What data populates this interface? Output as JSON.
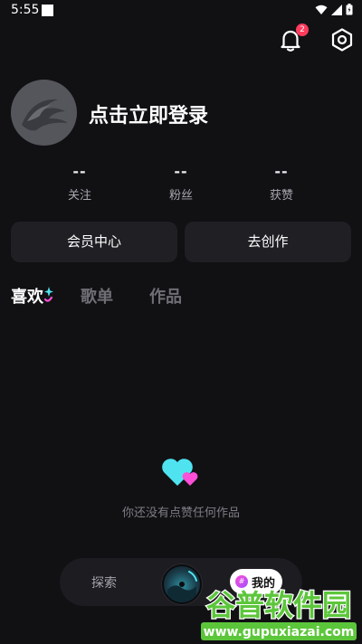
{
  "status_bar": {
    "time": "5:55"
  },
  "header": {
    "notification_count": "2"
  },
  "profile": {
    "login_prompt": "点击立即登录"
  },
  "stats": [
    {
      "value": "--",
      "label": "关注"
    },
    {
      "value": "--",
      "label": "粉丝"
    },
    {
      "value": "--",
      "label": "获赞"
    }
  ],
  "actions": {
    "vip_center": "会员中心",
    "create": "去创作"
  },
  "tabs": [
    "喜欢",
    "歌单",
    "作品"
  ],
  "empty_state": {
    "message": "你还没有点赞任何作品"
  },
  "bottom_nav": {
    "explore": "探索",
    "mine": "我的",
    "mine_icon_char": "#"
  },
  "watermark": {
    "title": "谷普软件园",
    "url": "www.gupuxiazai.com"
  },
  "colors": {
    "background": "#111114",
    "card": "#1f1f24",
    "accent_pink": "#ff4fd8",
    "accent_cyan": "#4fe3f0",
    "badge": "#ff3b5c",
    "watermark_green": "#5cc63b"
  }
}
